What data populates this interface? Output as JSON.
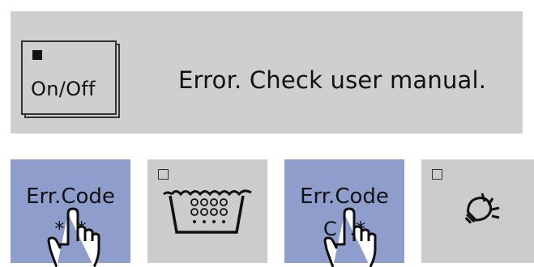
{
  "panel": {
    "power_button": {
      "label": "On/Off",
      "indicator": "filled-square-icon"
    },
    "message": "Error. Check user manual."
  },
  "buttons": [
    {
      "line1": "Err.Code",
      "line2": "*  *",
      "color": "#8e9dcb",
      "icon": "hand-pointer-icon"
    },
    {
      "indicator": "empty-square-icon",
      "icon": "water-basin-icon",
      "color": "#cccccc"
    },
    {
      "line1": "Err.Code",
      "line2": "C  :*",
      "color": "#8e9dcb",
      "icon": "hand-pointer-icon"
    },
    {
      "indicator": "empty-square-icon",
      "icon": "lightbulb-icon",
      "color": "#cccccc"
    }
  ],
  "colors": {
    "display_bg": "#cfcfcf",
    "accent_blue": "#8e9dcb"
  }
}
